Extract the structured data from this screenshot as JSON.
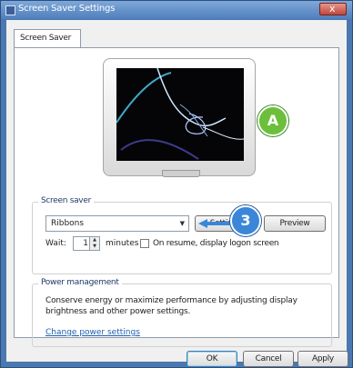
{
  "window": {
    "title": "Screen Saver Settings",
    "close_glyph": "x"
  },
  "tab": {
    "label": "Screen Saver"
  },
  "preview": {
    "badge_a": "A",
    "badge_3": "3"
  },
  "screen_saver": {
    "group_title": "Screen saver",
    "selected": "Ribbons",
    "settings_label": "Settings",
    "preview_label": "Preview",
    "wait_label": "Wait:",
    "wait_value": "1",
    "minutes_label": "minutes",
    "resume_label": "On resume, display logon screen"
  },
  "power": {
    "group_title": "Power management",
    "description": "Conserve energy or maximize performance by adjusting display brightness and other power settings.",
    "link": "Change power settings"
  },
  "footer": {
    "ok": "OK",
    "cancel": "Cancel",
    "apply": "Apply"
  },
  "colors": {
    "title_bar": "#4f7fbc",
    "badge_green": "#6cbf3a",
    "badge_blue": "#3b86d9",
    "link": "#2060b0"
  }
}
